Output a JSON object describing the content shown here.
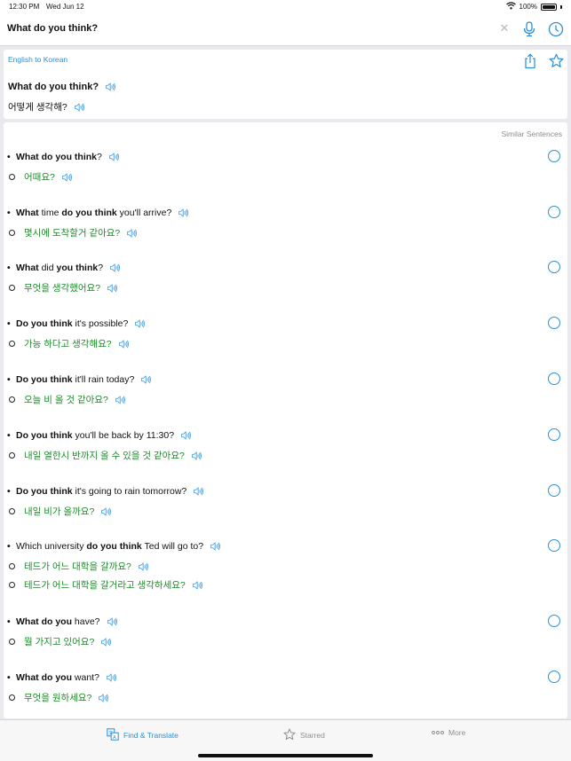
{
  "status": {
    "time": "12:30 PM",
    "date": "Wed Jun 12",
    "battery": "100%"
  },
  "search": {
    "query": "What do you think?"
  },
  "translation": {
    "language_label": "English to Korean",
    "english": "What do you think?",
    "korean": "어떻게 생각해?"
  },
  "similar": {
    "label": "Similar Sentences",
    "entries": [
      {
        "en": [
          {
            "t": "What do you think",
            "b": true
          },
          {
            "t": "?",
            "b": false
          }
        ],
        "ko": [
          "어때요?"
        ]
      },
      {
        "en": [
          {
            "t": "What",
            "b": true
          },
          {
            "t": " time ",
            "b": false
          },
          {
            "t": "do you think",
            "b": true
          },
          {
            "t": " you'll arrive?",
            "b": false
          }
        ],
        "ko": [
          "몇시에 도착할거 같아요?"
        ]
      },
      {
        "en": [
          {
            "t": "What",
            "b": true
          },
          {
            "t": " did ",
            "b": false
          },
          {
            "t": "you think",
            "b": true
          },
          {
            "t": "?",
            "b": false
          }
        ],
        "ko": [
          "무엇을 생각했어요?"
        ]
      },
      {
        "en": [
          {
            "t": "Do you think",
            "b": true
          },
          {
            "t": " it's possible?",
            "b": false
          }
        ],
        "ko": [
          "가능 하다고 생각해요?"
        ]
      },
      {
        "en": [
          {
            "t": "Do you think",
            "b": true
          },
          {
            "t": " it'll rain today?",
            "b": false
          }
        ],
        "ko": [
          "오늘 비 올 것 같아요?"
        ]
      },
      {
        "en": [
          {
            "t": "Do you think",
            "b": true
          },
          {
            "t": " you'll be back by 11:30?",
            "b": false
          }
        ],
        "ko": [
          "내일 열한시 반까지 올 수 있을 것 같아요?"
        ]
      },
      {
        "en": [
          {
            "t": "Do you think",
            "b": true
          },
          {
            "t": " it's going to rain tomorrow?",
            "b": false
          }
        ],
        "ko": [
          "내일 비가 올까요?"
        ]
      },
      {
        "en": [
          {
            "t": "Which university ",
            "b": false
          },
          {
            "t": "do you think",
            "b": true
          },
          {
            "t": " Ted will go to?",
            "b": false
          }
        ],
        "ko": [
          "테드가 어느 대학을 갈까요?",
          "테드가 어느 대학을 갈거라고 생각하세요?"
        ]
      },
      {
        "en": [
          {
            "t": "What do you",
            "b": true
          },
          {
            "t": " have?",
            "b": false
          }
        ],
        "ko": [
          "뭘 가지고 있어요?"
        ]
      },
      {
        "en": [
          {
            "t": "What do you",
            "b": true
          },
          {
            "t": " want?",
            "b": false
          }
        ],
        "ko": [
          "무엇을 원하세요?"
        ]
      }
    ]
  },
  "tabs": [
    {
      "label": "Find & Translate",
      "icon": "translate-icon",
      "active": true
    },
    {
      "label": "Starred",
      "icon": "star-icon",
      "active": false
    },
    {
      "label": "More",
      "icon": "more-icon",
      "active": false
    }
  ],
  "colors": {
    "accent": "#2a8fd6",
    "korean_text": "#1d8a2a",
    "background": "#e9e9ee"
  }
}
